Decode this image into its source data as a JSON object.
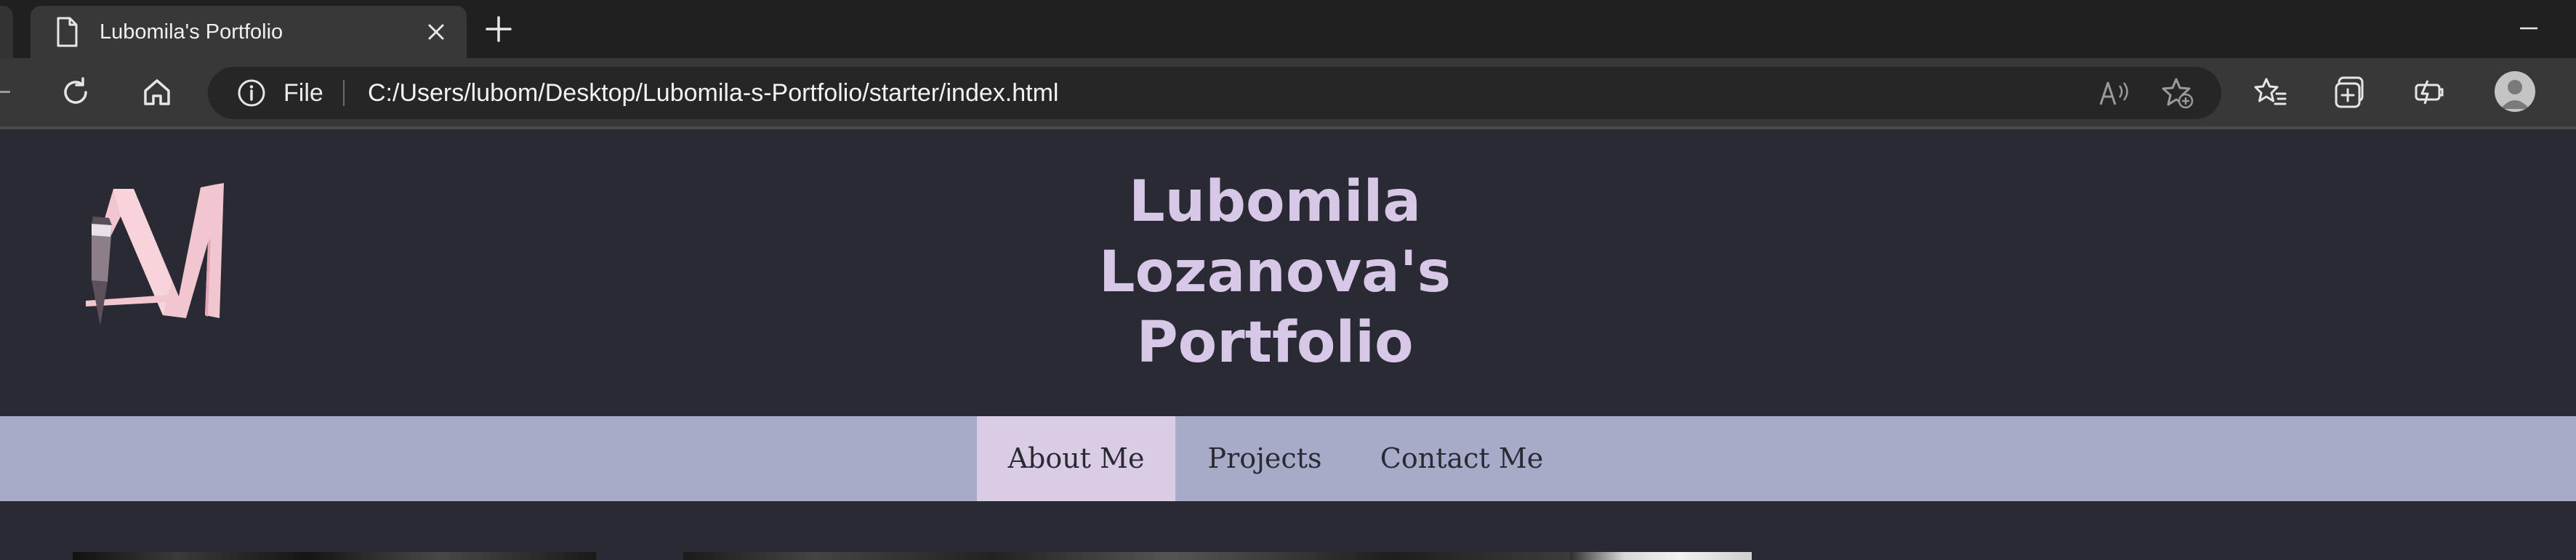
{
  "browser": {
    "tab": {
      "title": "Lubomila's Portfolio"
    },
    "address_bar": {
      "scheme_label": "File",
      "url": "C:/Users/lubom/Desktop/Lubomila-s-Portfolio/starter/index.html"
    }
  },
  "page": {
    "title": "Lubomila Lozanova's Portfolio",
    "title_lines": [
      "Lubomila",
      "Lozanova's",
      "Portfolio"
    ],
    "nav": {
      "items": [
        {
          "label": "About Me",
          "active": true
        },
        {
          "label": "Projects",
          "active": false
        },
        {
          "label": "Contact Me",
          "active": false
        }
      ]
    }
  },
  "colors": {
    "page_background": "#2a2a35",
    "title": "#d6c8e6",
    "nav_background": "#a7abc8",
    "nav_active": "#dbcce6",
    "logo_pink": "#f2c6cf"
  },
  "icons": [
    "page-icon",
    "close-icon",
    "plus-icon",
    "minimize-icon",
    "back-icon",
    "refresh-icon",
    "home-icon",
    "info-icon",
    "read-aloud-icon",
    "add-favorite-icon",
    "favorites-icon",
    "collections-icon",
    "performance-icon",
    "profile-icon"
  ]
}
